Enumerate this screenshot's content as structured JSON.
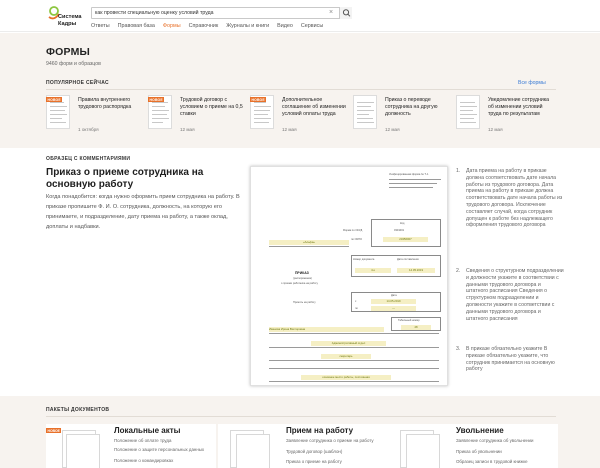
{
  "brand": {
    "line1": "Система",
    "line2": "Кадры"
  },
  "search": {
    "value": "как провести специальную оценку условий труда"
  },
  "nav": [
    {
      "label": "Ответы",
      "active": false
    },
    {
      "label": "Правовая база",
      "active": false
    },
    {
      "label": "Формы",
      "active": true
    },
    {
      "label": "Справочник",
      "active": false
    },
    {
      "label": "Журналы и книги",
      "active": false
    },
    {
      "label": "Видео",
      "active": false
    },
    {
      "label": "Сервисы",
      "active": false
    }
  ],
  "forms": {
    "title": "ФОРМЫ",
    "count": "9460 форм и образцов",
    "popular_title": "ПОПУЛЯРНОЕ СЕЙЧАС",
    "all_forms": "Все формы",
    "cards": [
      {
        "badge": "НОВОЕ",
        "title": "Правила внутреннего трудового распорядка",
        "date": "1 октября"
      },
      {
        "badge": "НОВОЕ",
        "title": "Трудовой договор с условием о приеме на 0,5 ставки",
        "date": "12 мая"
      },
      {
        "badge": "НОВОЕ",
        "title": "Дополнительное соглашение об изменении условий оплаты труда",
        "date": "12 мая"
      },
      {
        "badge": "",
        "title": "Приказ о переводе сотрудника на другую должность",
        "date": "12 мая"
      },
      {
        "badge": "",
        "title": "Уведомление сотрудника об изменении условий труда по результатам",
        "date": "12 мая"
      }
    ]
  },
  "sample": {
    "label": "ОБРАЗЕЦ С КОММЕНТАРИЯМИ",
    "title": "Приказ о приеме сотрудника на основную работу",
    "description": "Когда понадобится: когда нужно оформить прием сотрудника на работу. В приказе пропишите Ф. И. О. сотрудника, должность, на которую его принимаете, и подразделение, дату приема на работу, а также оклад, доплаты и надбавки.",
    "doc": {
      "header_right": "Унифицированная форма № Т-1",
      "org": "«Альфа»",
      "code_label": "Код",
      "okud_label": "Форма по ОКУД",
      "okpo_label": "по ОКПО",
      "okud_value": "0301001",
      "okpo_value": "23456007",
      "num_label": "Номер документа",
      "date_label": "Дата составления",
      "num_value": "4-к",
      "date_value": "14.05.2019",
      "order_word": "ПРИКАЗ",
      "order_sub": "(распоряжение)",
      "order_desc": "о приеме работника на работу",
      "hire_label": "Принять на работу",
      "date_col": "Дата",
      "from_label": "с",
      "to_label": "по",
      "from_value": "14.05.2019",
      "to_value": "—",
      "tab_label": "Табельный номер",
      "tab_value": "28",
      "employee": "Иванова Ирина Викторовна",
      "dept": "Административный отдел",
      "position": "секретарь",
      "conditions": "основное место работы, постоянная"
    }
  },
  "notes": [
    {
      "num": "1.",
      "text": "Дата приема на работу в приказе должна соответствовать дате начала работы из трудового договора. Дата приема на работу в приказе должна соответствовать дате начала работы из трудового договора. Исключение составляет случай, когда сотрудник допущен к работе без надлежащего оформления трудового договора"
    },
    {
      "num": "2.",
      "text": "Сведения о структурном подразделении и должности укажите в соответствии с данными трудового договора и штатного расписания Сведения о структурном подразделении и должности укажите в соответствии с данными трудового договора и штатного расписания"
    },
    {
      "num": "3.",
      "text": "В приказе обязательно укажите В приказе обязательно укажите, что сотрудник принимается на основную работу"
    }
  ],
  "packages": {
    "title": "ПАКЕТЫ ДОКУМЕНТОВ",
    "items": [
      {
        "badge": "НОВОЕ",
        "title": "Локальные акты",
        "links": [
          "Положение об оплате труда",
          "Положение о защите персональных данных",
          "Положение о командировках"
        ]
      },
      {
        "badge": "",
        "title": "Прием на работу",
        "links": [
          "Заявление сотрудника о приеме на работу",
          "Трудовой договор (шаблон)",
          "Приказ о приеме на работу"
        ]
      },
      {
        "badge": "",
        "title": "Увольнение",
        "links": [
          "Заявление сотрудника об увольнении",
          "Приказ об увольнении",
          "Образец записи в трудовой книжке"
        ]
      }
    ]
  }
}
